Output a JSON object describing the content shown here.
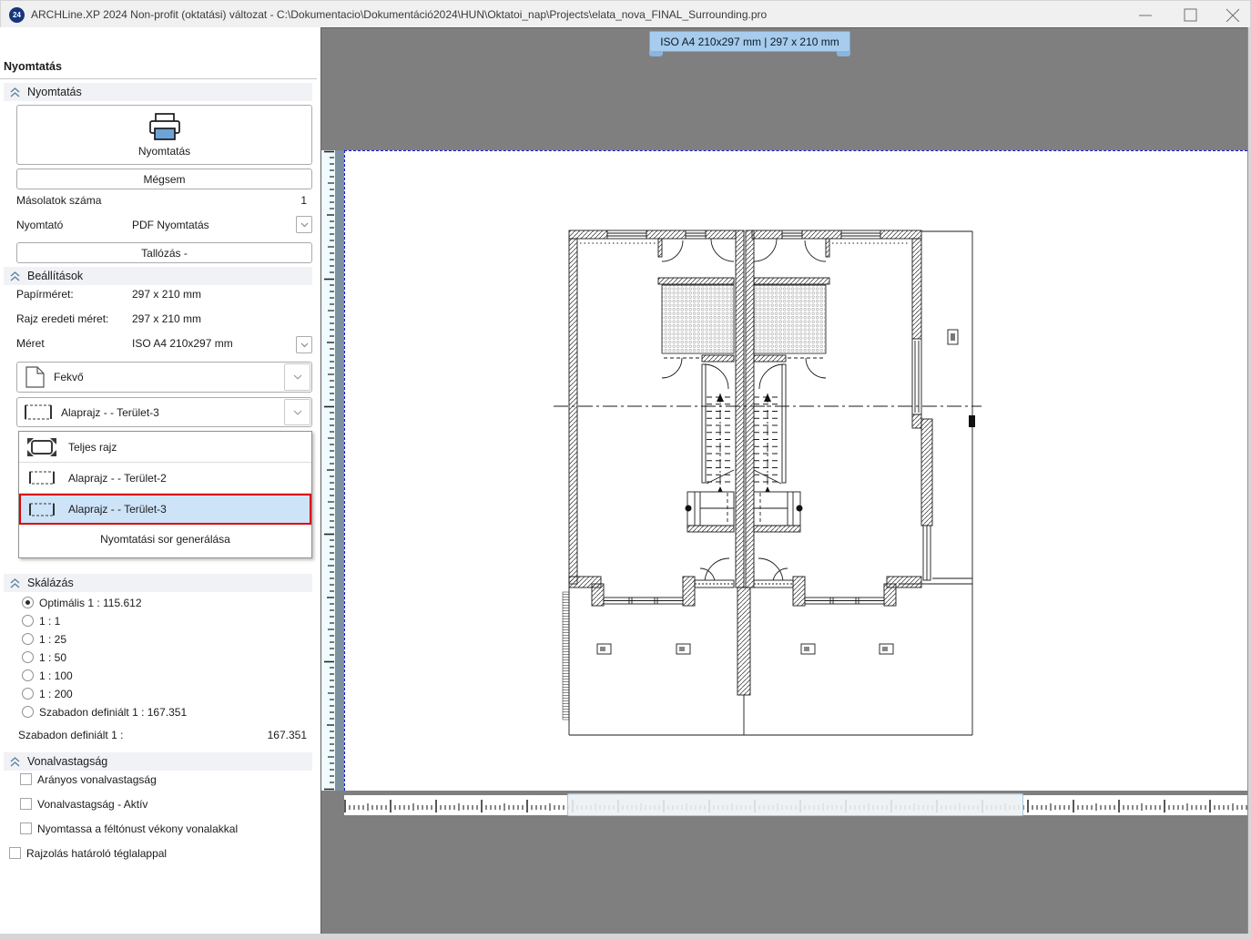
{
  "window": {
    "title": "ARCHLine.XP 2024 Non-profit (oktatási) változat - C:\\Dokumentacio\\Dokumentáció2024\\HUN\\Oktatoi_nap\\Projects\\elata_nova_FINAL_Surrounding.pro"
  },
  "sidebar": {
    "title": "Nyomtatás",
    "print": {
      "header": "Nyomtatás",
      "print_button": "Nyomtatás",
      "cancel_button": "Mégsem",
      "copies_label": "Másolatok száma",
      "copies_value": "1",
      "printer_label": "Nyomtató",
      "printer_value": "PDF Nyomtatás",
      "browse_button": "Tallózás -"
    },
    "settings": {
      "header": "Beállítások",
      "rows": [
        {
          "label": "Papírméret:",
          "value": "297 x 210 mm"
        },
        {
          "label": "Rajz eredeti méret:",
          "value": "297 x 210 mm"
        },
        {
          "label": "Méret",
          "value": "ISO A4 210x297 mm"
        }
      ],
      "orientation": "Fekvő",
      "view": "Alaprajz -  - Terület-3",
      "dropdown": {
        "items": [
          {
            "label": "Teljes rajz"
          },
          {
            "label": "Alaprajz -  - Terület-2"
          },
          {
            "label": "Alaprajz -  - Terület-3"
          }
        ],
        "action": "Nyomtatási sor generálása"
      }
    },
    "scaling": {
      "header": "Skálázás",
      "options": [
        {
          "label": "Optimális 1 : 115.612"
        },
        {
          "label": "1 : 1"
        },
        {
          "label": "1 : 25"
        },
        {
          "label": "1 : 50"
        },
        {
          "label": "1 : 100"
        },
        {
          "label": "1 : 200"
        },
        {
          "label": "Szabadon definiált 1 :  167.351"
        }
      ],
      "custom_label": "Szabadon definiált 1 :",
      "custom_value": "167.351"
    },
    "lineweight": {
      "header": "Vonalvastagság",
      "options": [
        {
          "label": "Arányos vonalvastagság"
        },
        {
          "label": "Vonalvastagság - Aktív"
        },
        {
          "label": "Nyomtassa a féltónust vékony vonalakkal"
        }
      ]
    },
    "draw_boundary": "Rajzolás határoló téglalappal"
  },
  "preview": {
    "tooltip": "ISO A4 210x297 mm | 297 x 210 mm"
  }
}
